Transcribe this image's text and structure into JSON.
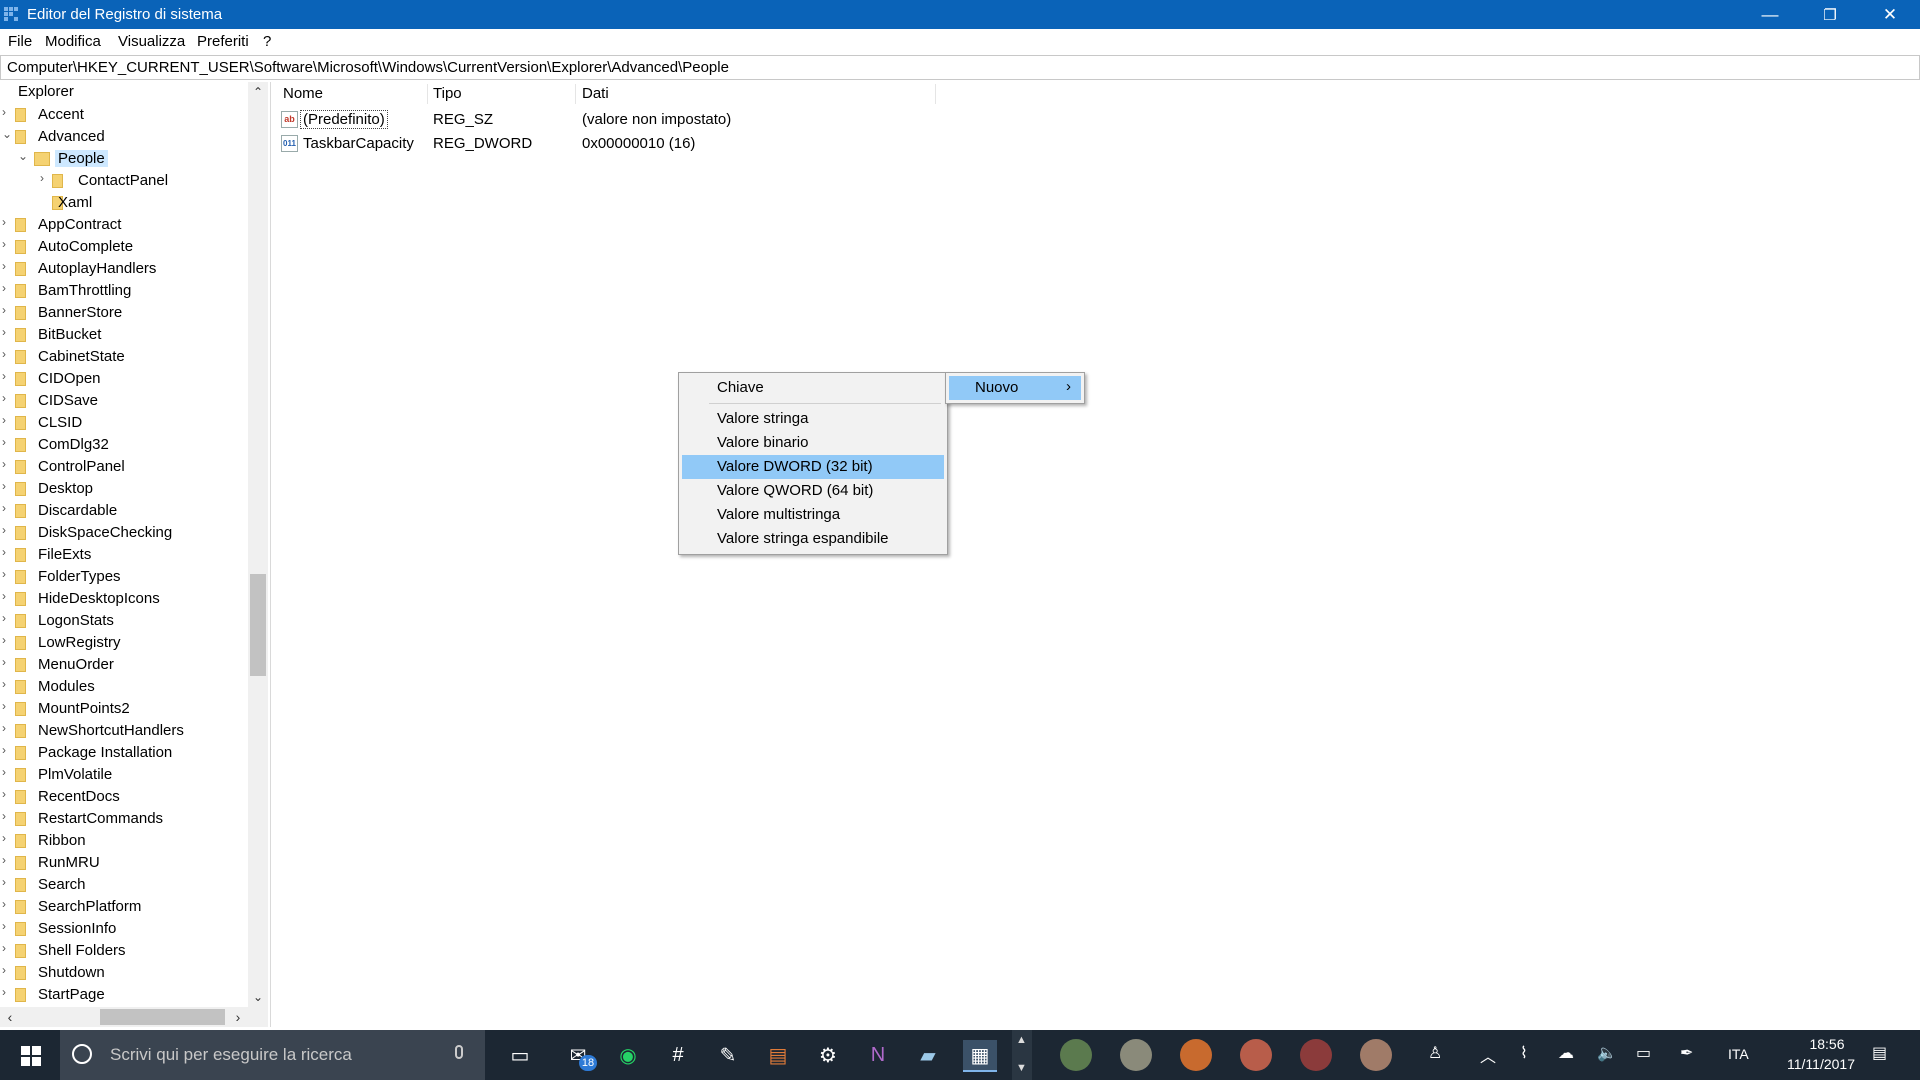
{
  "window": {
    "title": "Editor del Registro di sistema",
    "minimize": "—",
    "restore": "❐",
    "close": "✕"
  },
  "menu": [
    "File",
    "Modifica",
    "Visualizza",
    "Preferiti",
    "?"
  ],
  "address": "Computer\\HKEY_CURRENT_USER\\Software\\Microsoft\\Windows\\CurrentVersion\\Explorer\\Advanced\\People",
  "tree": {
    "root": "Explorer",
    "items": [
      {
        "label": "Accent",
        "level": 1
      },
      {
        "label": "Advanced",
        "level": 1,
        "expanded": true
      },
      {
        "label": "People",
        "level": 2,
        "expanded": true,
        "selected": true
      },
      {
        "label": "ContactPanel",
        "level": 3,
        "collapsed": true
      },
      {
        "label": "Xaml",
        "level": 3
      },
      {
        "label": "AppContract",
        "level": 1
      },
      {
        "label": "AutoComplete",
        "level": 1
      },
      {
        "label": "AutoplayHandlers",
        "level": 1
      },
      {
        "label": "BamThrottling",
        "level": 1
      },
      {
        "label": "BannerStore",
        "level": 1
      },
      {
        "label": "BitBucket",
        "level": 1
      },
      {
        "label": "CabinetState",
        "level": 1
      },
      {
        "label": "CIDOpen",
        "level": 1
      },
      {
        "label": "CIDSave",
        "level": 1
      },
      {
        "label": "CLSID",
        "level": 1
      },
      {
        "label": "ComDlg32",
        "level": 1
      },
      {
        "label": "ControlPanel",
        "level": 1
      },
      {
        "label": "Desktop",
        "level": 1
      },
      {
        "label": "Discardable",
        "level": 1
      },
      {
        "label": "DiskSpaceChecking",
        "level": 1
      },
      {
        "label": "FileExts",
        "level": 1
      },
      {
        "label": "FolderTypes",
        "level": 1
      },
      {
        "label": "HideDesktopIcons",
        "level": 1
      },
      {
        "label": "LogonStats",
        "level": 1
      },
      {
        "label": "LowRegistry",
        "level": 1
      },
      {
        "label": "MenuOrder",
        "level": 1
      },
      {
        "label": "Modules",
        "level": 1
      },
      {
        "label": "MountPoints2",
        "level": 1
      },
      {
        "label": "NewShortcutHandlers",
        "level": 1
      },
      {
        "label": "Package Installation",
        "level": 1
      },
      {
        "label": "PlmVolatile",
        "level": 1
      },
      {
        "label": "RecentDocs",
        "level": 1
      },
      {
        "label": "RestartCommands",
        "level": 1
      },
      {
        "label": "Ribbon",
        "level": 1
      },
      {
        "label": "RunMRU",
        "level": 1
      },
      {
        "label": "Search",
        "level": 1
      },
      {
        "label": "SearchPlatform",
        "level": 1
      },
      {
        "label": "SessionInfo",
        "level": 1
      },
      {
        "label": "Shell Folders",
        "level": 1
      },
      {
        "label": "Shutdown",
        "level": 1
      },
      {
        "label": "StartPage",
        "level": 1
      }
    ]
  },
  "list": {
    "headers": {
      "name": "Nome",
      "type": "Tipo",
      "data": "Dati"
    },
    "rows": [
      {
        "name": "(Predefinito)",
        "type": "REG_SZ",
        "data": "(valore non impostato)",
        "icon": "ab"
      },
      {
        "name": "TaskbarCapacity",
        "type": "REG_DWORD",
        "data": "0x00000010 (16)",
        "icon": "011"
      }
    ]
  },
  "context_menu": {
    "items": [
      {
        "label": "Chiave"
      },
      {
        "label": "Valore stringa"
      },
      {
        "label": "Valore binario"
      },
      {
        "label": "Valore DWORD (32 bit)",
        "highlighted": true
      },
      {
        "label": "Valore QWORD (64 bit)"
      },
      {
        "label": "Valore multistringa"
      },
      {
        "label": "Valore stringa espandibile"
      }
    ],
    "submenu_parent": "Nuovo",
    "submenu_arrow": "›"
  },
  "taskbar": {
    "search_placeholder": "Scrivi qui per eseguire la ricerca",
    "mail_badge": "18",
    "language": "ITA",
    "time": "18:56",
    "date": "11/11/2017"
  },
  "colors": {
    "titlebar": "#0a63b8",
    "selection": "#cde8ff",
    "menu_highlight": "#91c9f7",
    "taskbar": "#1c2733"
  }
}
